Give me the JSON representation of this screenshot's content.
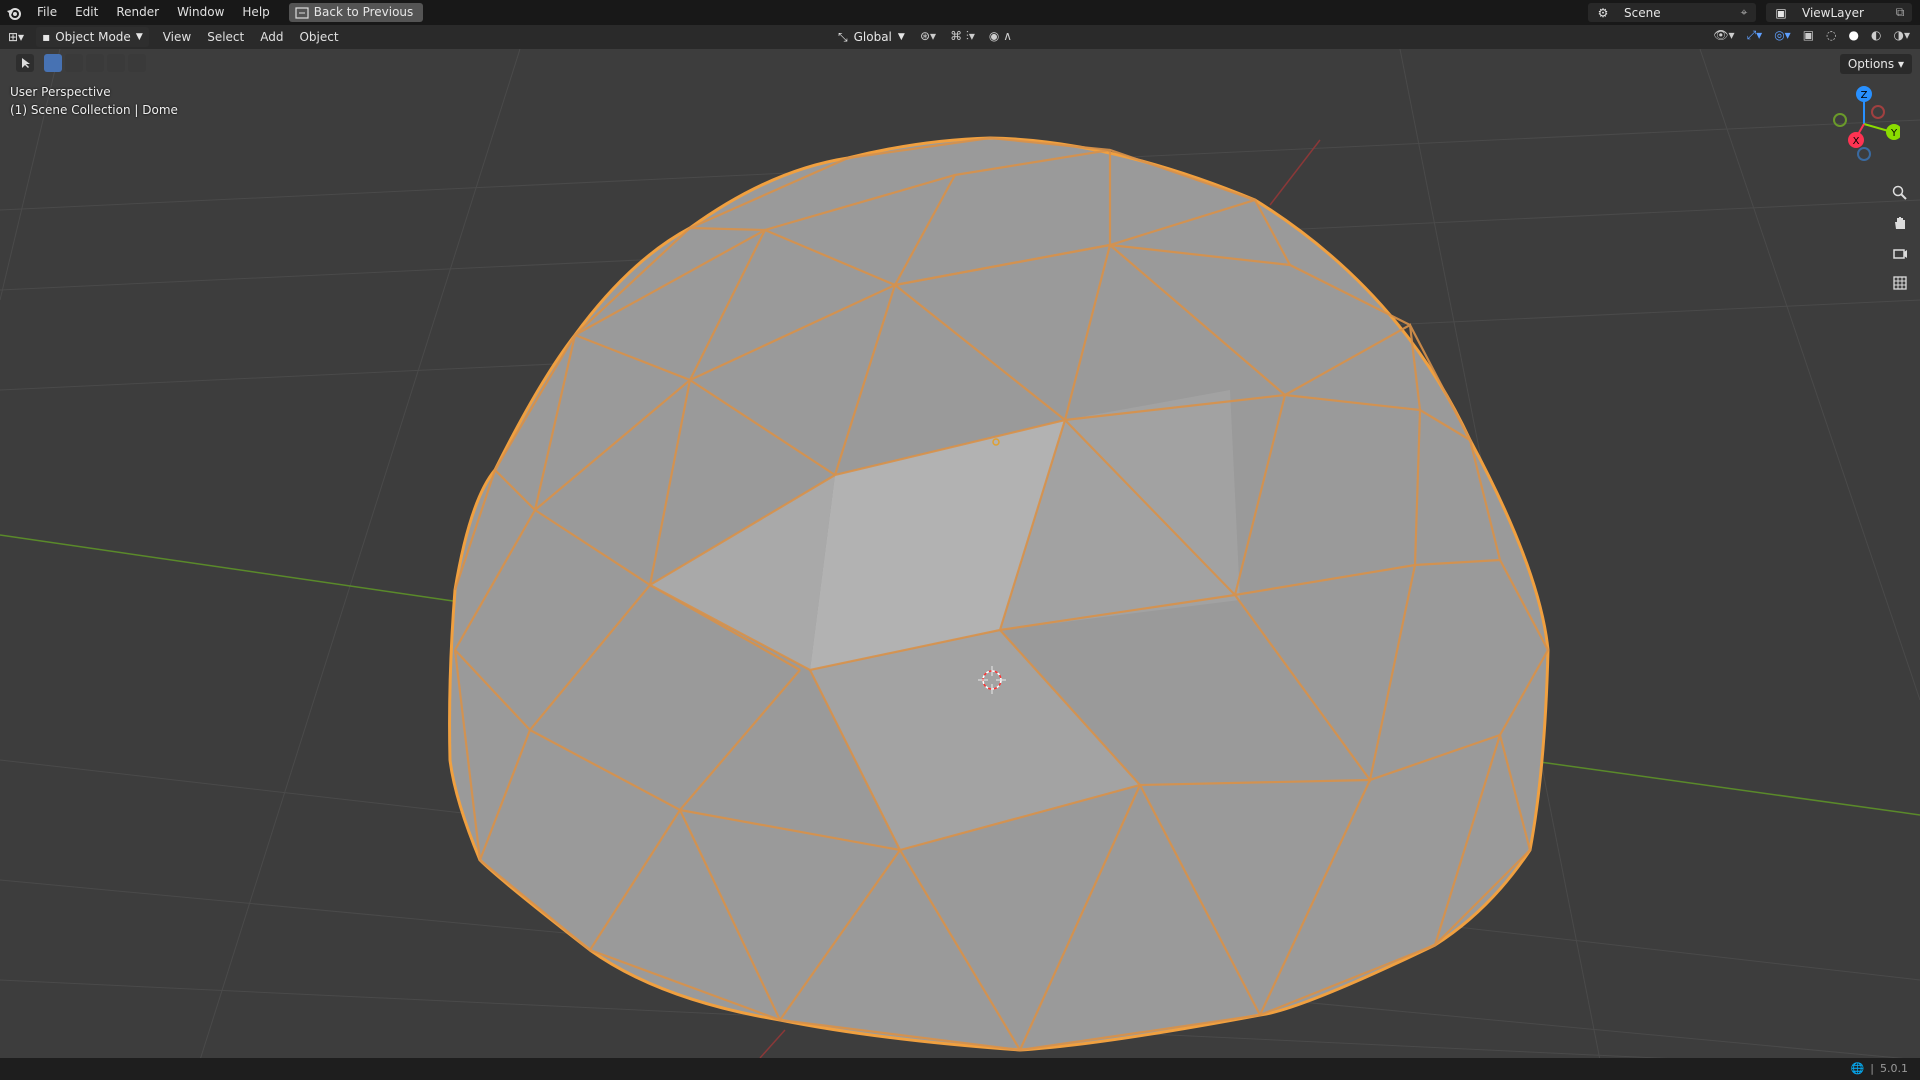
{
  "topbar": {
    "menus": [
      "File",
      "Edit",
      "Render",
      "Window",
      "Help"
    ],
    "back_button": "Back to Previous",
    "scene_name": "Scene",
    "view_layer": "ViewLayer"
  },
  "header": {
    "mode": "Object Mode",
    "menus": [
      "View",
      "Select",
      "Add",
      "Object"
    ],
    "transform_orientation": "Global",
    "options_label": "Options"
  },
  "viewport": {
    "perspective_label": "User Perspective",
    "collection_label": "(1) Scene Collection | Dome",
    "gizmo_axes": {
      "x": "X",
      "y": "Y",
      "z": "Z"
    }
  },
  "statusbar": {
    "version": "5.0.1"
  },
  "colors": {
    "selection_outline": "#f0a040",
    "x_axis": "#ff3352",
    "y_axis": "#8bdc00",
    "z_axis": "#2890ff",
    "background": "#3d3d3d"
  },
  "icons": [
    "blender-logo-icon",
    "editor-type-icon",
    "select-box-icon",
    "transform-orientation-icon",
    "pivot-icon",
    "snap-icon",
    "proportional-edit-icon",
    "zoom-icon",
    "pan-hand-icon",
    "camera-icon",
    "grid-perspective-icon",
    "globe-icon"
  ]
}
